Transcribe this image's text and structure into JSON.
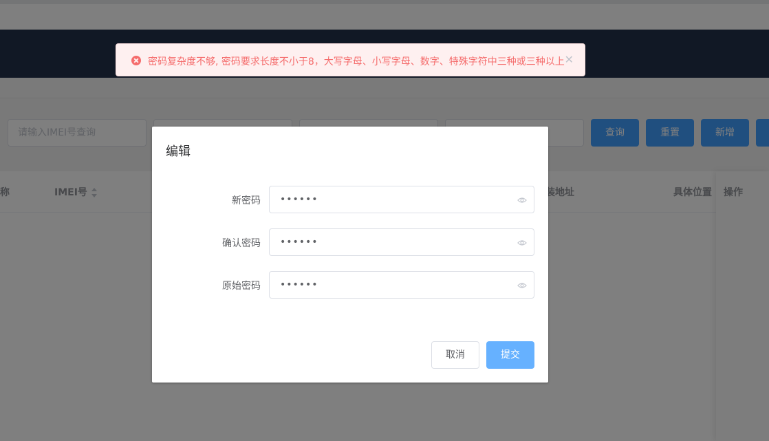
{
  "search": {
    "imei_placeholder": "请输入IMEI号查询",
    "buttons": {
      "query": "查询",
      "reset": "重置",
      "add": "新增"
    }
  },
  "table": {
    "columns": {
      "name_partial": "称",
      "imei": "IMEI号",
      "address_partial": "装地址",
      "location": "具体位置",
      "actions": "操作"
    }
  },
  "dialog": {
    "title": "编辑",
    "fields": [
      {
        "label": "新密码",
        "value": "••••••"
      },
      {
        "label": "确认密码",
        "value": "••••••"
      },
      {
        "label": "原始密码",
        "value": "••••••"
      }
    ],
    "cancel_label": "取消",
    "submit_label": "提交"
  },
  "message": {
    "type": "error",
    "text": "密码复杂度不够, 密码要求长度不小于8，大写字母、小写字母、数字、特殊字符中三种或三种以上",
    "close_glyph": "✕"
  },
  "colors": {
    "primary": "#409eff",
    "primary_light": "#66b1ff",
    "error": "#f56c6c",
    "error_bg": "#fef0f0",
    "navbar": "#22304a"
  }
}
